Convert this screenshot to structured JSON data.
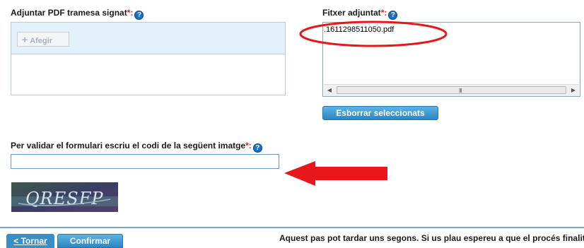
{
  "upload": {
    "label": "Adjuntar PDF tramesa signat",
    "required_mark": "*:",
    "help": "?",
    "add_button": "Afegir"
  },
  "attached": {
    "label": "Fitxer adjuntat",
    "required_mark": "*:",
    "help": "?",
    "files": [
      ".1611298511050.pdf"
    ],
    "scroll_grip": "III",
    "delete_button": "Esborrar seleccionats"
  },
  "captcha": {
    "label": "Per validar el formulari escriu el codi de la següent imatge",
    "required_mark": "*:",
    "help": "?",
    "input_value": "",
    "image_text": "QRESFP"
  },
  "footer": {
    "back_label": "< Tornar",
    "confirm_label": "Confirmar",
    "message": "Aquest pas pot tardar uns segons. Si us plau espereu a que el procés finalit"
  },
  "colors": {
    "annotation_red": "#e8171b",
    "primary_blue": "#2b86c4",
    "panel_bg": "#e3f1fa"
  }
}
